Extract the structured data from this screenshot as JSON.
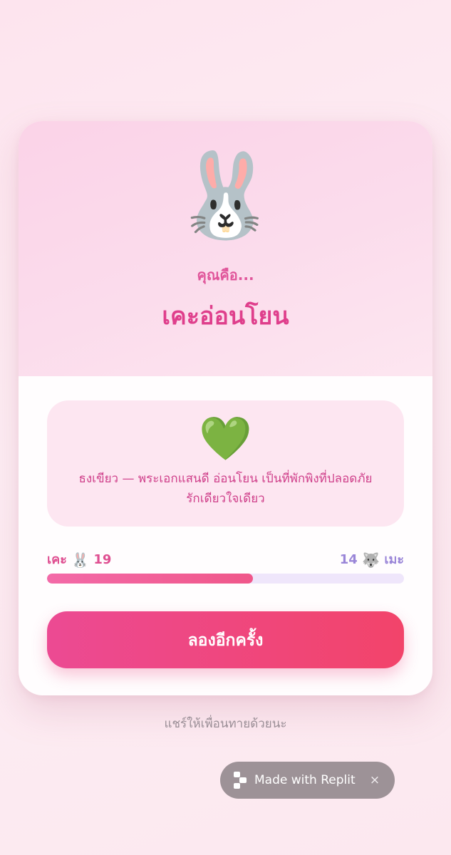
{
  "result": {
    "emoji": "🐰",
    "subtitle": "คุณคือ...",
    "title": "เคะอ่อนโยน"
  },
  "description": {
    "icon": "green-heart-icon",
    "icon_glyph": "💚",
    "text": "ธงเขียว — พระเอกแสนดี อ่อนโยน เป็นที่พักพิงที่ปลอดภัย รักเดียวใจเดียว"
  },
  "scores": {
    "left_label": "เคะ",
    "left_emoji": "🐰",
    "left_value": "19",
    "right_label": "เมะ",
    "right_emoji": "🐺",
    "right_value": "14",
    "left_fraction": 0.576
  },
  "actions": {
    "retry_label": "ลองอีกครั้ง"
  },
  "footer": {
    "share_hint": "แชร์ให้เพื่อนทายด้วยนะ",
    "badge_label": "Made with Replit",
    "badge_close": "×"
  },
  "colors": {
    "accent": "#df3f8c",
    "button_start": "#ec4a93",
    "button_end": "#f2446a",
    "bar_track": "#efe6fb",
    "right_score": "#9a86d8"
  }
}
